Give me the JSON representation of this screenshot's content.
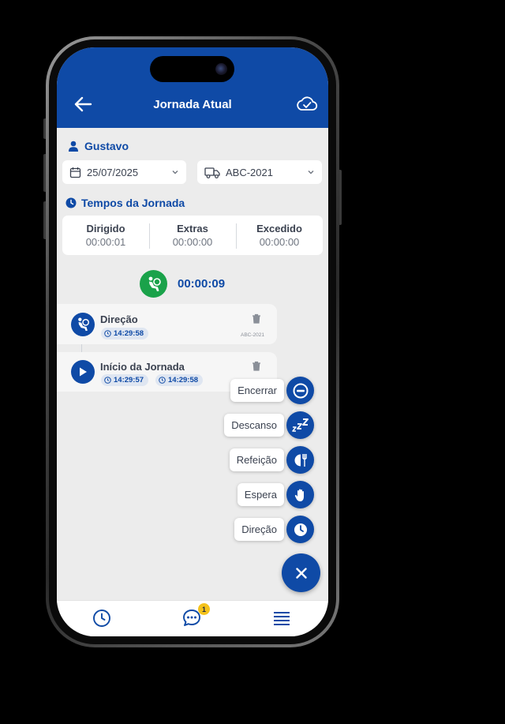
{
  "header": {
    "title": "Jornada Atual"
  },
  "user": {
    "name": "Gustavo"
  },
  "filters": {
    "date": "25/07/2025",
    "vehicle": "ABC-2021"
  },
  "times": {
    "section_title": "Tempos da Jornada",
    "columns": [
      {
        "label": "Dirigido",
        "value": "00:00:01"
      },
      {
        "label": "Extras",
        "value": "00:00:00"
      },
      {
        "label": "Excedido",
        "value": "00:00:00"
      }
    ]
  },
  "current_status": {
    "timer": "00:00:09"
  },
  "events": [
    {
      "title": "Direção",
      "start": "14:29:58",
      "plate": "ABC-2021"
    },
    {
      "title": "Início da Jornada",
      "start": "14:29:57",
      "end": "14:29:58"
    }
  ],
  "fab_menu": [
    {
      "label": "Encerrar",
      "icon": "minus-circle-icon"
    },
    {
      "label": "Descanso",
      "icon": "sleep-zzz-icon"
    },
    {
      "label": "Refeição",
      "icon": "meal-icon"
    },
    {
      "label": "Espera",
      "icon": "hand-stop-icon"
    },
    {
      "label": "Direção",
      "icon": "clock-icon"
    }
  ],
  "bottom_nav": {
    "chat_badge": "1"
  },
  "colors": {
    "primary": "#0f4aa6",
    "background": "#ececec",
    "status_green": "#1aa24a",
    "badge_yellow": "#f4c21b",
    "text": "#3b4250"
  }
}
